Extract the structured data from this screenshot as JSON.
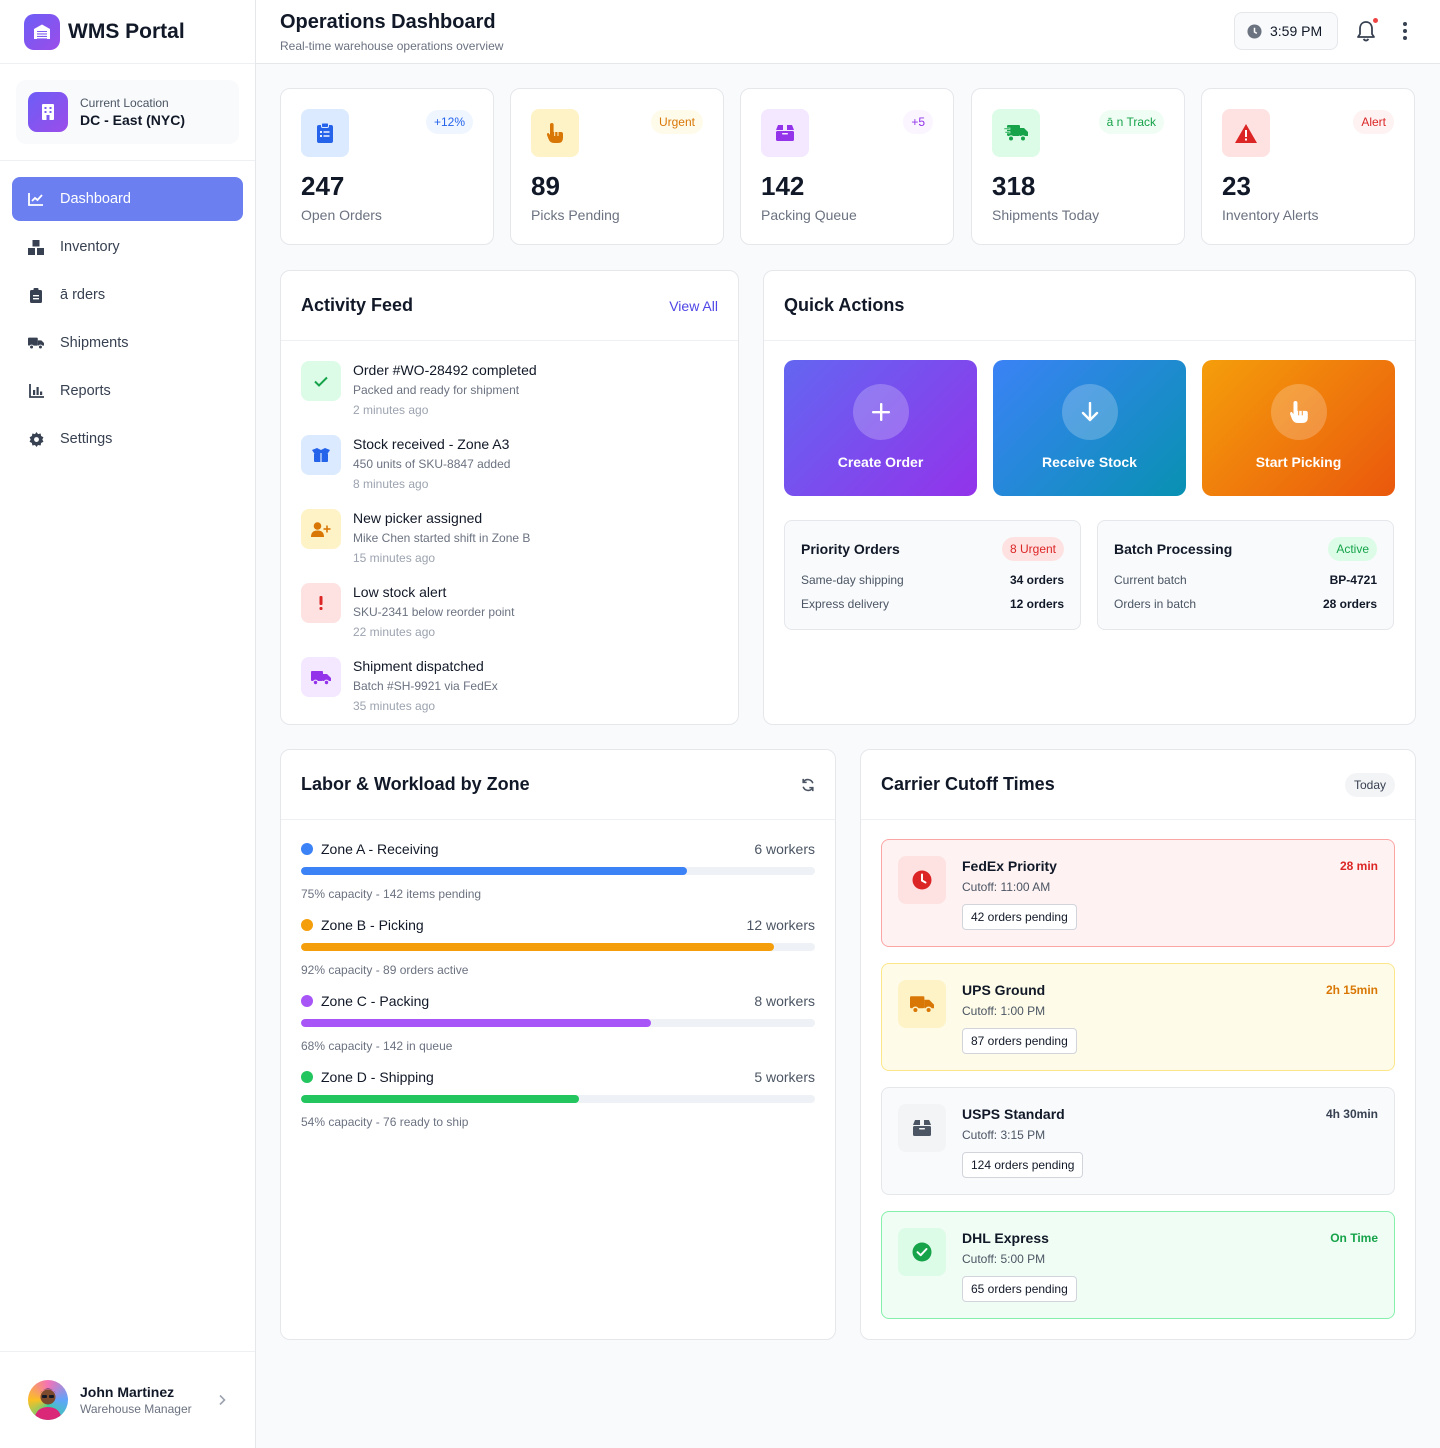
{
  "brand": {
    "name": "WMS Portal"
  },
  "location": {
    "label": "Current Location",
    "value": "DC - East (NYC)"
  },
  "nav": [
    {
      "label": "Dashboard",
      "icon": "chart-line-icon",
      "active": true
    },
    {
      "label": "Inventory",
      "icon": "boxes-icon"
    },
    {
      "label": "ā rders",
      "icon": "clipboard-icon"
    },
    {
      "label": "Shipments",
      "icon": "truck-icon"
    },
    {
      "label": "Reports",
      "icon": "bar-chart-icon"
    },
    {
      "label": "Settings",
      "icon": "gear-icon"
    }
  ],
  "user": {
    "name": "John Martinez",
    "role": "Warehouse Manager"
  },
  "header": {
    "title": "Operations Dashboard",
    "subtitle": "Real-time warehouse operations overview",
    "time": "3:59 PM"
  },
  "stats": [
    {
      "value": "247",
      "label": "Open Orders",
      "badge": "+12%",
      "icon": "clipboard-list-icon",
      "color": "#2563eb",
      "bg": "#dbeafe",
      "badge_bg": "#eff6ff"
    },
    {
      "value": "89",
      "label": "Picks Pending",
      "badge": "Urgent",
      "icon": "hand-pointer-icon",
      "color": "#d97706",
      "bg": "#fef3c7",
      "badge_bg": "#fffbeb"
    },
    {
      "value": "142",
      "label": "Packing Queue",
      "badge": "+5",
      "icon": "box-icon",
      "color": "#9333ea",
      "bg": "#f3e8ff",
      "badge_bg": "#faf5ff"
    },
    {
      "value": "318",
      "label": "Shipments Today",
      "badge": "ā n Track",
      "icon": "truck-fast-icon",
      "color": "#16a34a",
      "bg": "#dcfce7",
      "badge_bg": "#f0fdf4"
    },
    {
      "value": "23",
      "label": "Inventory Alerts",
      "badge": "Alert",
      "icon": "warning-icon",
      "color": "#dc2626",
      "bg": "#fee2e2",
      "badge_bg": "#fef2f2"
    }
  ],
  "activity": {
    "title": "Activity Feed",
    "view_all": "View All",
    "items": [
      {
        "title": "Order #WO-28492 completed",
        "desc": "Packed and ready for shipment",
        "time": "2 minutes ago",
        "icon": "check-icon",
        "color": "#16a34a",
        "bg": "#dcfce7"
      },
      {
        "title": "Stock received - Zone A3",
        "desc": "450 units of SKU-8847 added",
        "time": "8 minutes ago",
        "icon": "box-open-icon",
        "color": "#2563eb",
        "bg": "#dbeafe"
      },
      {
        "title": "New picker assigned",
        "desc": "Mike Chen started shift in Zone B",
        "time": "15 minutes ago",
        "icon": "user-plus-icon",
        "color": "#d97706",
        "bg": "#fef3c7"
      },
      {
        "title": "Low stock alert",
        "desc": "SKU-2341 below reorder point",
        "time": "22 minutes ago",
        "icon": "exclamation-icon",
        "color": "#dc2626",
        "bg": "#fee2e2"
      },
      {
        "title": "Shipment dispatched",
        "desc": "Batch #SH-9921 via FedEx",
        "time": "35 minutes ago",
        "icon": "truck-icon",
        "color": "#9333ea",
        "bg": "#f3e8ff"
      }
    ]
  },
  "quick_actions": {
    "title": "Quick Actions",
    "buttons": [
      {
        "label": "Create Order",
        "icon": "plus-icon"
      },
      {
        "label": "Receive Stock",
        "icon": "arrow-down-icon"
      },
      {
        "label": "Start Picking",
        "icon": "hand-pointer-icon"
      }
    ],
    "priority": {
      "title": "Priority Orders",
      "badge": "8 Urgent",
      "rows": [
        {
          "k": "Same-day shipping",
          "v": "34 orders"
        },
        {
          "k": "Express delivery",
          "v": "12 orders"
        }
      ]
    },
    "batch": {
      "title": "Batch Processing",
      "badge": "Active",
      "rows": [
        {
          "k": "Current batch",
          "v": "BP-4721"
        },
        {
          "k": "Orders in batch",
          "v": "28 orders"
        }
      ]
    }
  },
  "labor": {
    "title": "Labor & Workload by Zone",
    "zones": [
      {
        "name": "Zone A - Receiving",
        "workers": "6 workers",
        "note": "75% capacity - 142 items pending",
        "capacity": 0.75,
        "color": "#3b82f6"
      },
      {
        "name": "Zone B - Picking",
        "workers": "12 workers",
        "note": "92% capacity - 89 orders active",
        "capacity": 0.92,
        "color": "#f59e0b"
      },
      {
        "name": "Zone C - Packing",
        "workers": "8 workers",
        "note": "68% capacity - 142 in queue",
        "capacity": 0.68,
        "color": "#a855f7"
      },
      {
        "name": "Zone D - Shipping",
        "workers": "5 workers",
        "note": "54% capacity - 76 ready to ship",
        "capacity": 0.54,
        "color": "#22c55e"
      }
    ]
  },
  "carriers": {
    "title": "Carrier Cutoff Times",
    "badge": "Today",
    "items": [
      {
        "name": "FedEx Priority",
        "cutoff": "Cutoff: 11:00 AM",
        "pending": "42 orders pending",
        "time": "28 min",
        "icon": "clock-icon",
        "color": "#dc2626",
        "bg": "#fef2f2",
        "border": "#fca5a5",
        "icon_bg": "#fee2e2",
        "time_color": "#dc2626"
      },
      {
        "name": "UPS Ground",
        "cutoff": "Cutoff: 1:00 PM",
        "pending": "87 orders pending",
        "time": "2h 15min",
        "icon": "truck-icon",
        "color": "#d97706",
        "bg": "#fefce8",
        "border": "#fde68a",
        "icon_bg": "#fef3c7",
        "time_color": "#d97706"
      },
      {
        "name": "USPS Standard",
        "cutoff": "Cutoff: 3:15 PM",
        "pending": "124 orders pending",
        "time": "4h 30min",
        "icon": "box-icon",
        "color": "#4b5563",
        "bg": "#f8fafc",
        "border": "#e5e7eb",
        "icon_bg": "#f3f4f6",
        "time_color": "#374151"
      },
      {
        "name": "DHL Express",
        "cutoff": "Cutoff: 5:00 PM",
        "pending": "65 orders pending",
        "time": "On Time",
        "icon": "check-circle-icon",
        "color": "#16a34a",
        "bg": "#f0fdf4",
        "border": "#86efac",
        "icon_bg": "#dcfce7",
        "time_color": "#16a34a"
      }
    ]
  }
}
